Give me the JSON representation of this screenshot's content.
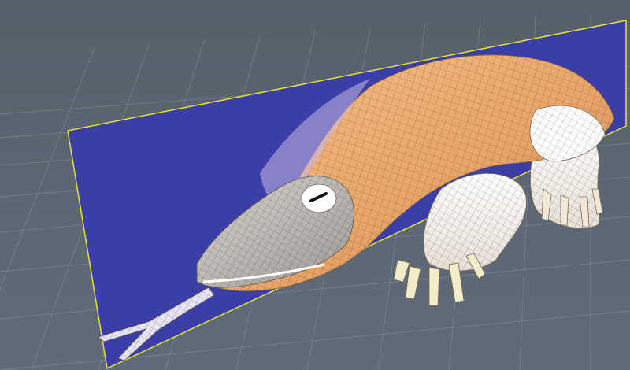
{
  "viewport": {
    "view": "perspective",
    "background_color": "#5a6470",
    "grid_color": "#8c96a1",
    "symmetry_plane_color": "#3a3ea6",
    "symmetry_plane_outline": "#e6e23a",
    "object_color": "#f0b27a",
    "subdivision_wire_color": "#3b2a1a"
  },
  "model": {
    "icon": "lizard-mesh-icon",
    "shading": "wireframe-on-shaded"
  }
}
